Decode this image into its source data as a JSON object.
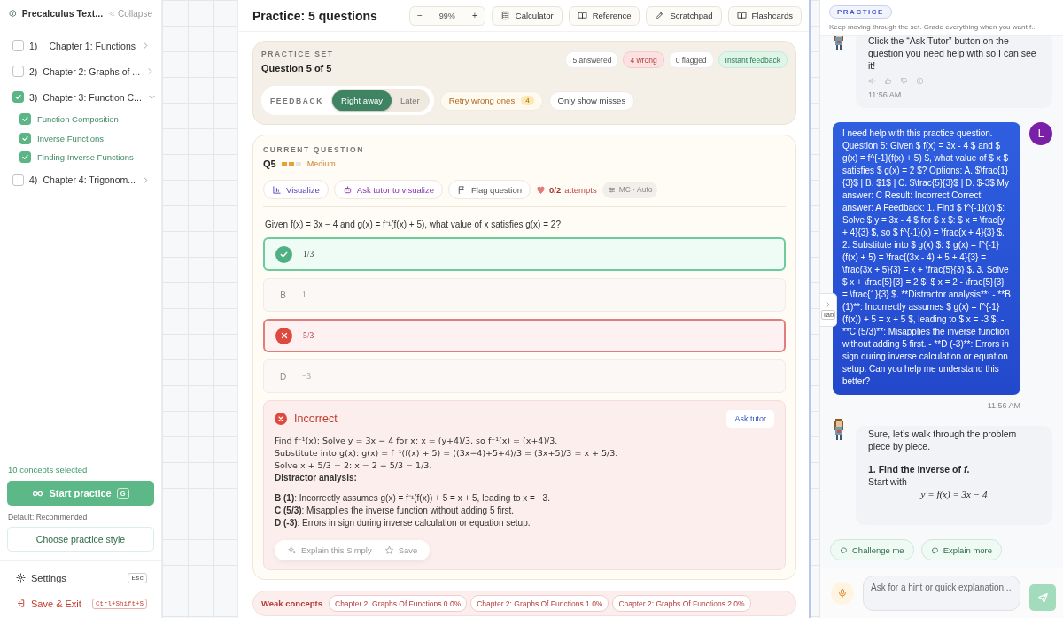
{
  "sidebar": {
    "title": "Precalculus Text...",
    "collapse": "Collapse",
    "chapters": [
      {
        "number": "1)",
        "title": "Chapter 1: Functions",
        "checked": false,
        "expanded": false
      },
      {
        "number": "2)",
        "title": "Chapter 2: Graphs of ...",
        "checked": false,
        "expanded": false
      },
      {
        "number": "3)",
        "title": "Chapter 3: Function C...",
        "checked": true,
        "expanded": true,
        "children": [
          {
            "title": "Function Composition",
            "checked": true
          },
          {
            "title": "Inverse Functions",
            "checked": true
          },
          {
            "title": "Finding Inverse Functions",
            "checked": true
          }
        ]
      },
      {
        "number": "4)",
        "title": "Chapter 4: Trigonom...",
        "checked": false,
        "expanded": false
      }
    ],
    "selection_summary": "10 concepts selected",
    "start_button": {
      "label": "Start practice",
      "shortcut": "G"
    },
    "default_note": "Default: Recommended",
    "style_button": "Choose practice style",
    "footer": [
      {
        "kind": "settings",
        "label": "Settings",
        "shortcut": "Esc"
      },
      {
        "kind": "exit",
        "label": "Save & Exit",
        "shortcut": "Ctrl+Shift+S"
      }
    ]
  },
  "practice": {
    "title": "Practice: 5 questions",
    "zoom": {
      "minus": "−",
      "value": "99%",
      "plus": "+"
    },
    "tools": [
      {
        "kind": "calculator",
        "label": "Calculator"
      },
      {
        "kind": "reference",
        "label": "Reference"
      },
      {
        "kind": "scratchpad",
        "label": "Scratchpad"
      },
      {
        "kind": "flashcards",
        "label": "Flashcards"
      }
    ],
    "set": {
      "label": "PRACTICE SET",
      "position": "Question 5 of 5",
      "stats": [
        {
          "kind": "neutral",
          "text": "5 answered"
        },
        {
          "kind": "wrong",
          "text": "4 wrong"
        },
        {
          "kind": "neutral",
          "text": "0 flagged"
        },
        {
          "kind": "good",
          "text": "Instant feedback"
        }
      ],
      "feedback": {
        "label": "FEEDBACK",
        "options": [
          {
            "label": "Right away",
            "selected": true
          },
          {
            "label": "Later",
            "selected": false
          }
        ]
      },
      "retry": {
        "label": "Retry wrong ones",
        "count": "4"
      },
      "misses": "Only show misses"
    },
    "question": {
      "label": "CURRENT QUESTION",
      "number": "Q5",
      "difficulty": {
        "level": 0.67,
        "text": "Medium"
      },
      "actions": [
        {
          "kind": "visualize",
          "label": "Visualize"
        },
        {
          "kind": "ask",
          "label": "Ask tutor to visualize"
        },
        {
          "kind": "flag",
          "label": "Flag question"
        }
      ],
      "attempts": {
        "count": "0/2",
        "label": "attempts"
      },
      "mode": "MC · Auto",
      "prompt": "Given f(x) = 3x − 4 and g(x) = f⁻¹(f(x) + 5), what value of x satisfies g(x) = 2?",
      "options": [
        {
          "kind": "correct",
          "answer": "1/3"
        },
        {
          "kind": "plain",
          "letter": "B",
          "answer": "1"
        },
        {
          "kind": "wrong",
          "answer": "5/3"
        },
        {
          "kind": "plain",
          "letter": "D",
          "answer": "−3"
        }
      ],
      "feedback": {
        "title": "Incorrect",
        "ask_button": "Ask tutor",
        "lines": [
          {
            "kind": "math",
            "text": "Find f⁻¹(x): Solve y = 3x − 4 for x: x = (y+4)/3, so f⁻¹(x) = (x+4)/3."
          },
          {
            "kind": "math",
            "text": "Substitute into g(x): g(x) = f⁻¹(f(x) + 5) = ((3x−4)+5+4)/3 = (3x+5)/3 = x + 5/3."
          },
          {
            "kind": "math",
            "text": "Solve x + 5/3 = 2: x = 2 − 5/3 = 1/3."
          },
          {
            "kind": "heading",
            "text": "Distractor analysis:"
          },
          {
            "kind": "bullet",
            "text": "**B (1)**: Incorrectly assumes g(x) = f⁻¹(f(x)) + 5 = x + 5, leading to x = −3."
          },
          {
            "kind": "bullet",
            "text": "**C (5/3)**: Misapplies the inverse function without adding 5 first."
          },
          {
            "kind": "bullet",
            "text": "**D (-3)**: Errors in sign during inverse calculation or equation setup."
          }
        ],
        "actions": [
          {
            "kind": "explain",
            "label": "Explain this Simply"
          },
          {
            "kind": "save",
            "label": "Save"
          }
        ]
      }
    },
    "weak_concepts": {
      "label": "Weak concepts",
      "chips": [
        "Chapter 2: Graphs Of Functions 0 0%",
        "Chapter 2: Graphs Of Functions 1 0%",
        "Chapter 2: Graphs Of Functions 2 0%"
      ]
    }
  },
  "chat": {
    "mode": "PRACTICE",
    "subtitle": "Keep moving through the set. Grade everything when you want f...",
    "tab_handle": "Tab",
    "messages": [
      {
        "kind": "tutor",
        "blocks": [
          {
            "kind": "text",
            "text": "Click the “Ask Tutor” button on the question you need help with so I can see it!"
          }
        ],
        "time": "11:56 AM"
      },
      {
        "kind": "user",
        "avatar": "L",
        "text": "I need help with this practice question. Question 5: Given $ f(x) = 3x - 4 $ and $ g(x) = f^{-1}(f(x) + 5) $, what value of $ x $ satisfies $ g(x) = 2 $? Options: A. $\\frac{1}{3}$ | B. $1$ | C. $\\frac{5}{3}$ | D. $-3$ My answer: C Result: Incorrect Correct answer: A Feedback: 1. Find $ f^{-1}(x) $: Solve $ y = 3x - 4 $ for $ x $: $ x = \\frac{y + 4}{3} $, so $ f^{-1}(x) = \\frac{x + 4}{3} $. 2. Substitute into $ g(x) $: $ g(x) = f^{-1}(f(x) + 5) = \\frac{(3x - 4) + 5 + 4}{3} = \\frac{3x + 5}{3} = x + \\frac{5}{3} $. 3. Solve $ x + \\frac{5}{3} = 2 $: $ x = 2 - \\frac{5}{3} = \\frac{1}{3} $. **Distractor analysis**: - **B (1)**: Incorrectly assumes $ g(x) = f^{-1}(f(x)) + 5 = x + 5 $, leading to $ x = -3 $. - **C (5/3)**: Misapplies the inverse function without adding 5 first. - **D (-3)**: Errors in sign during inverse calculation or equation setup. Can you help me understand this better?",
        "time": "11:56 AM"
      },
      {
        "kind": "tutor",
        "blocks": [
          {
            "kind": "text",
            "text": "Sure, let’s walk through the problem piece by piece."
          },
          {
            "kind": "heading",
            "text": "1. Find the inverse of *f*."
          },
          {
            "kind": "text",
            "text": "Start with"
          },
          {
            "kind": "equation",
            "text": "y = f(x) = 3x − 4"
          }
        ]
      }
    ],
    "suggestions": [
      "Challenge me",
      "Explain more"
    ],
    "input": {
      "placeholder": "Ask for a hint or quick explanation..."
    }
  }
}
